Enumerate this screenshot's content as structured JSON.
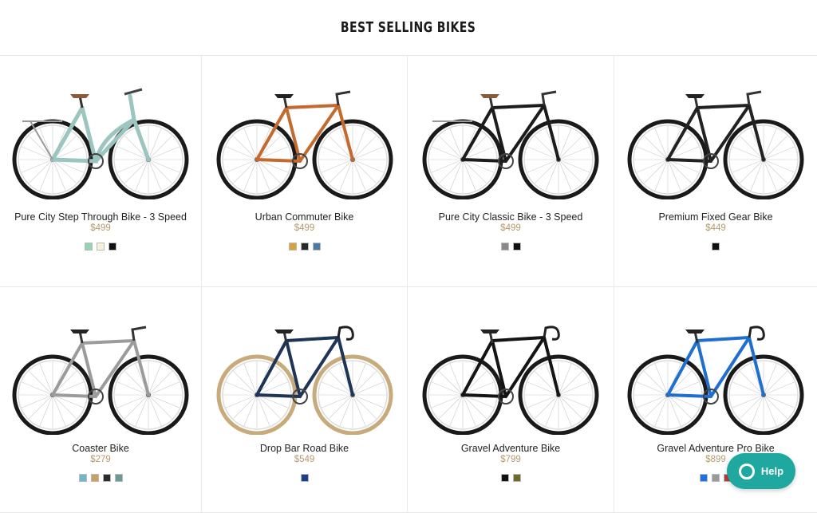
{
  "page": {
    "title": "BEST SELLING BIKES"
  },
  "help": {
    "label": "Help"
  },
  "products": [
    {
      "name": "Pure City Step Through Bike - 3 Speed",
      "price": "$499",
      "frame": "#9cc5c0",
      "tire": "#1a1a1a",
      "rim": "#dcdcdc",
      "style": "step",
      "swatches": [
        "#8fd6b4",
        "#f4f0dc",
        "#111111"
      ]
    },
    {
      "name": "Urban Commuter Bike",
      "price": "$499",
      "frame": "#c56a2e",
      "tire": "#1a1a1a",
      "rim": "#dcdcdc",
      "style": "urban",
      "swatches": [
        "#d8a438",
        "#2a2a2a",
        "#4a7aa8"
      ]
    },
    {
      "name": "Pure City Classic Bike - 3 Speed",
      "price": "$499",
      "frame": "#1c1c1c",
      "tire": "#1a1a1a",
      "rim": "#dcdcdc",
      "style": "classic",
      "swatches": [
        "#8a8a8a",
        "#111111"
      ]
    },
    {
      "name": "Premium Fixed Gear Bike",
      "price": "$449",
      "frame": "#222222",
      "tire": "#1a1a1a",
      "rim": "#dcdcdc",
      "style": "fixed",
      "swatches": [
        "#111111"
      ]
    },
    {
      "name": "Coaster Bike",
      "price": "$279",
      "frame": "#9b9b9b",
      "tire": "#1a1a1a",
      "rim": "#dcdcdc",
      "style": "coaster",
      "swatches": [
        "#6fb7c8",
        "#c9a060",
        "#2b2b2b",
        "#6e9a94"
      ]
    },
    {
      "name": "Drop Bar Road Bike",
      "price": "$549",
      "frame": "#1e3558",
      "tire": "#c8ab7a",
      "rim": "#dcdcdc",
      "style": "road",
      "swatches": [
        "#1c3f8a"
      ]
    },
    {
      "name": "Gravel Adventure Bike",
      "price": "$799",
      "frame": "#141414",
      "tire": "#1a1a1a",
      "rim": "#dcdcdc",
      "style": "gravel",
      "swatches": [
        "#111111",
        "#6e6a2c"
      ]
    },
    {
      "name": "Gravel Adventure Pro Bike",
      "price": "$899",
      "frame": "#1e6fd0",
      "tire": "#1a1a1a",
      "rim": "#dcdcdc",
      "style": "gravel",
      "swatches": [
        "#1e72e0",
        "#9a9a9a",
        "#c23a3a"
      ]
    }
  ]
}
